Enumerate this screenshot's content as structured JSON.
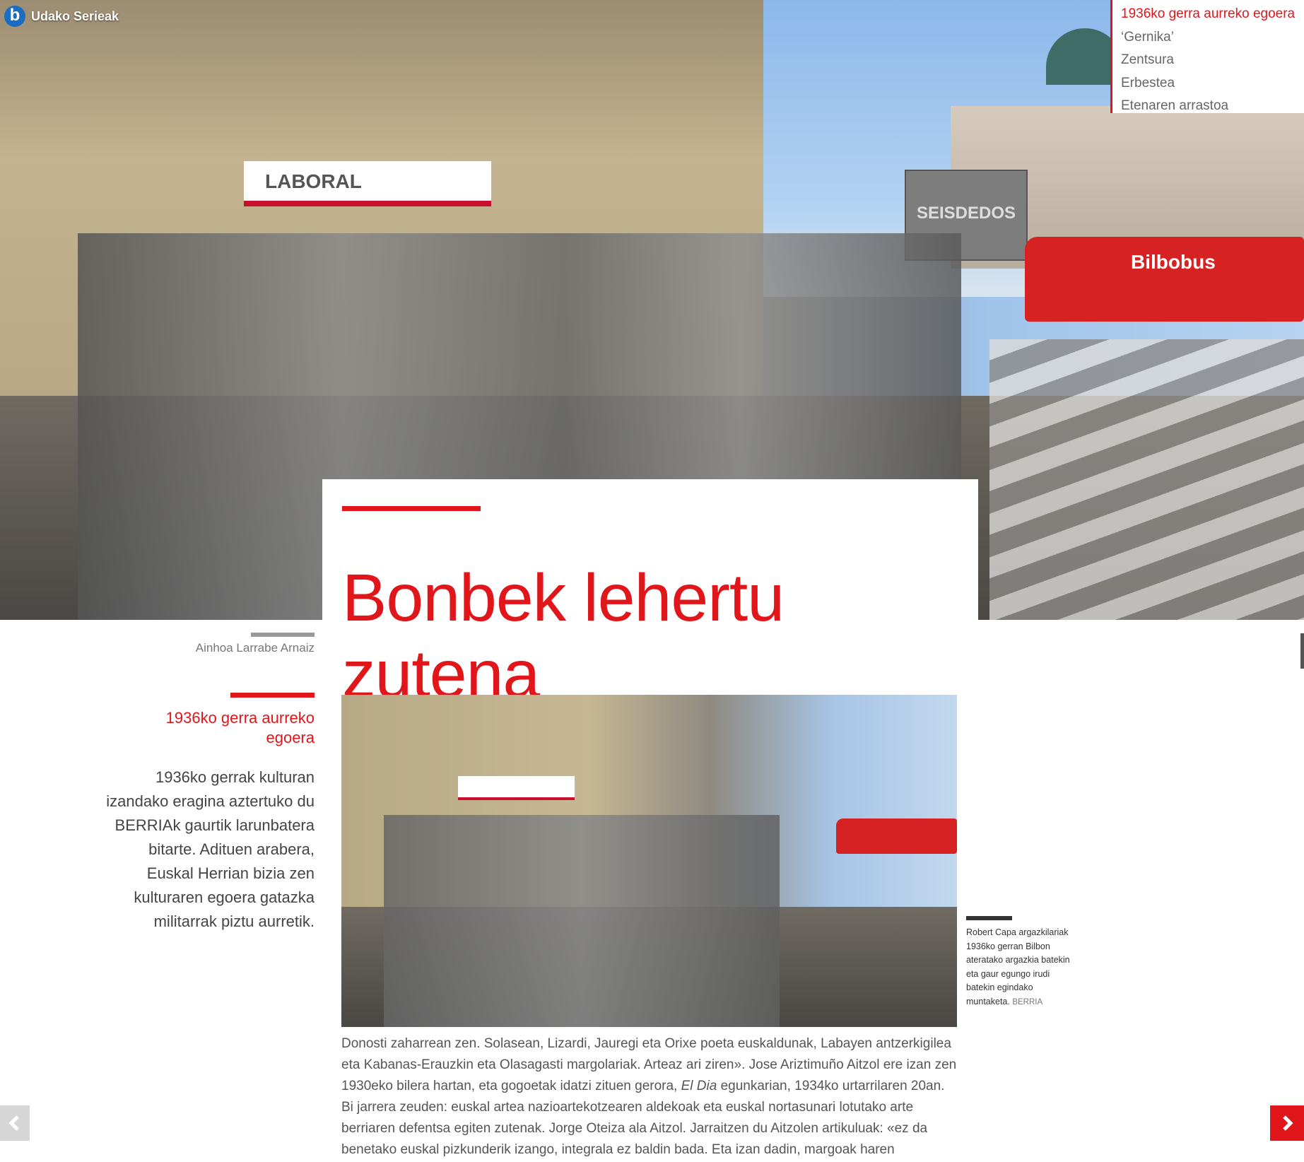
{
  "brand": {
    "logo_letter": "b",
    "name": "Udako Serieak",
    "logo_color": "#1a6dc1"
  },
  "chapters": {
    "items": [
      {
        "label": "1936ko gerra aurreko egoera",
        "active": true
      },
      {
        "label": "‘Gernika’",
        "active": false
      },
      {
        "label": "Zentsura",
        "active": false
      },
      {
        "label": "Erbestea",
        "active": false
      },
      {
        "label": "Etenaren arrastoa",
        "active": false
      }
    ]
  },
  "hero": {
    "laboral_sign": "LABORAL",
    "old_sign": "SEISDEDOS",
    "bus_label": "Bilbobus"
  },
  "article": {
    "title": "Bonbek lehertu zutena",
    "author": "Ainhoa Larrabe Arnaiz",
    "summary_title": "1936ko gerra aurreko egoera",
    "summary_text": "1936ko gerrak kulturan izandako eragina aztertuko du BERRIAk gaurtik larunbatera bitarte. Adituen arabera, Euskal Herrian bizia zen kulturaren egoera gatazka militarrak piztu aurretik.",
    "photo_caption": "Robert Capa argazkilariak 1936ko gerran Bilbon ateratako argazkia batekin eta gaur egungo irudi batekin egindako muntaketa.",
    "photo_credit": "BERRIA",
    "body_part1": "Donosti zaharrean zen. Solasean, Lizardi, Jauregi eta Orixe poeta euskaldunak, Labayen antzerkigilea eta Kabanas-Erauzkin eta Olasagasti margolariak. Arteaz ari ziren». Jose Ariztimuño Aitzol ere izan zen 1930eko bilera hartan, eta gogoetak idatzi zituen gerora,",
    "body_em": "El Dia",
    "body_part2": "egunkarian, 1934ko urtarrilaren 20an. Bi jarrera zeuden: euskal artea nazioartekotzearen aldekoak eta euskal nortasunari lotutako arte berriaren defentsa egiten zutenak. Jorge Oteiza ala Aitzol. Jarraitzen du Aitzolen artikuluak: «ez da benetako euskal pizkunderik izango, integrala ez baldin bada. Eta izan dadin, margoak haren"
  },
  "colors": {
    "accent": "#e0161b",
    "text": "#555555"
  },
  "navigation": {
    "prev_icon": "chevron-left-icon",
    "next_icon": "chevron-right-icon"
  }
}
